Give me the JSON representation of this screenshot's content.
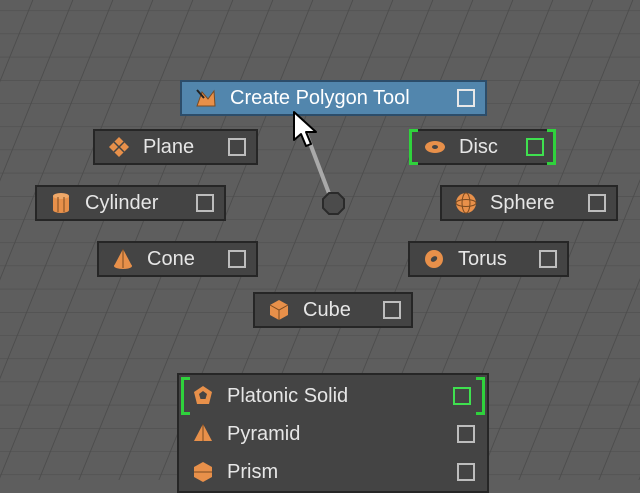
{
  "marking_menu": {
    "north": {
      "label": "Create Polygon Tool",
      "icon": "create-polygon-tool-icon",
      "highlighted": true,
      "option_box_checked": false
    },
    "north_west": {
      "label": "Plane",
      "icon": "plane-icon"
    },
    "north_east": {
      "label": "Disc",
      "icon": "disc-icon",
      "bracketed": true
    },
    "west": {
      "label": "Cylinder",
      "icon": "cylinder-icon"
    },
    "east": {
      "label": "Sphere",
      "icon": "sphere-icon"
    },
    "south_west": {
      "label": "Cone",
      "icon": "cone-icon"
    },
    "south_east": {
      "label": "Torus",
      "icon": "torus-icon"
    },
    "south": {
      "label": "Cube",
      "icon": "cube-icon"
    }
  },
  "submenu": {
    "items": [
      {
        "label": "Platonic Solid",
        "icon": "platonic-solid-icon",
        "bracketed": true
      },
      {
        "label": "Pyramid",
        "icon": "pyramid-icon"
      },
      {
        "label": "Prism",
        "icon": "prism-icon"
      }
    ]
  },
  "colors": {
    "background": "#5e5e5e",
    "grid_line": "#4a4a4a",
    "item_bg": "#444444",
    "highlight": "#5286ad",
    "icon_orange": "#e8904a",
    "selection_green": "#2fd23c"
  }
}
